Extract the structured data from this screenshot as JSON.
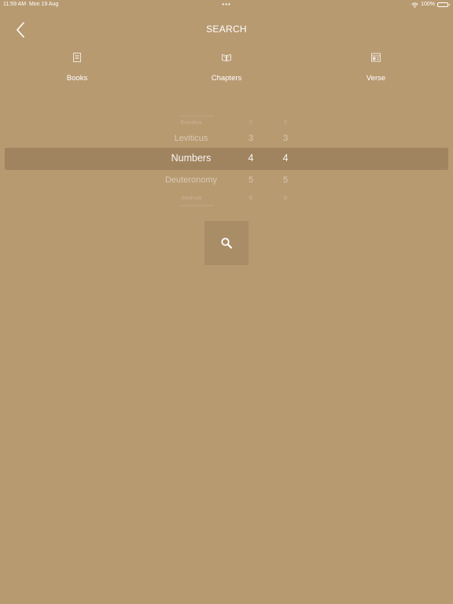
{
  "status_bar": {
    "time": "11:59 AM",
    "date": "Mon 19 Aug",
    "battery": "100%",
    "battery_level": 1.0
  },
  "nav": {
    "title": "SEARCH",
    "back_icon": "chevron-left-icon"
  },
  "tabs": [
    {
      "label": "Books",
      "icon": "book-icon"
    },
    {
      "label": "Chapters",
      "icon": "open-book-icon"
    },
    {
      "label": "Verse",
      "icon": "verse-layout-icon"
    }
  ],
  "picker": {
    "rows": [
      {
        "book": "Exodus",
        "chapter": "2",
        "verse": "2"
      },
      {
        "book": "Leviticus",
        "chapter": "3",
        "verse": "3"
      },
      {
        "book": "Numbers",
        "chapter": "4",
        "verse": "4"
      },
      {
        "book": "Deuteronomy",
        "chapter": "5",
        "verse": "5"
      },
      {
        "book": "Joshua",
        "chapter": "6",
        "verse": "6"
      }
    ],
    "selected_index": 2
  },
  "search_button": {
    "icon": "search-icon"
  },
  "colors": {
    "background": "#b89a71",
    "highlight": "#8c7352",
    "button": "#a98d67",
    "text": "#ffffff"
  }
}
